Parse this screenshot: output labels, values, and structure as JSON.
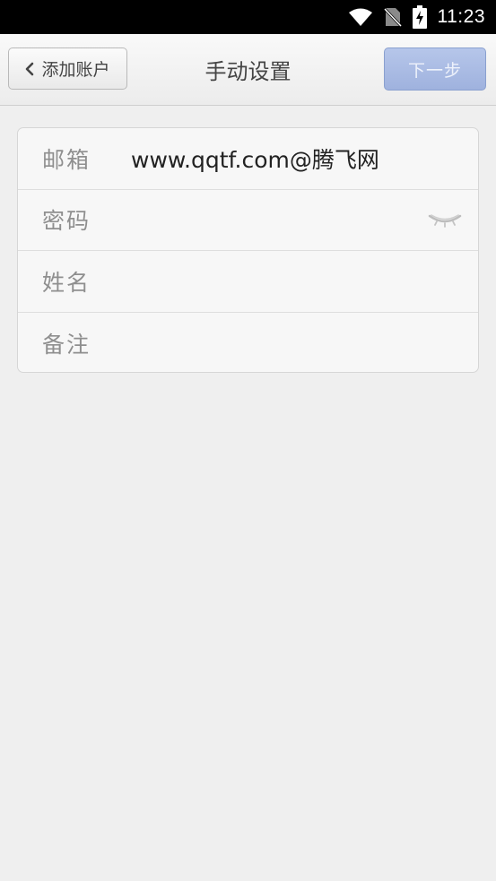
{
  "status_bar": {
    "time": "11:23",
    "icons": [
      "wifi-icon",
      "no-sim-icon",
      "battery-charging-icon"
    ]
  },
  "nav": {
    "back_label": "添加账户",
    "title": "手动设置",
    "next_label": "下一步"
  },
  "form": {
    "email": {
      "label": "邮箱",
      "value": "www.qqtf.com@腾飞网"
    },
    "password": {
      "label": "密码",
      "value": "",
      "toggle_icon": "eye-closed-icon"
    },
    "name": {
      "label": "姓名",
      "value": ""
    },
    "note": {
      "label": "备注",
      "value": ""
    }
  }
}
